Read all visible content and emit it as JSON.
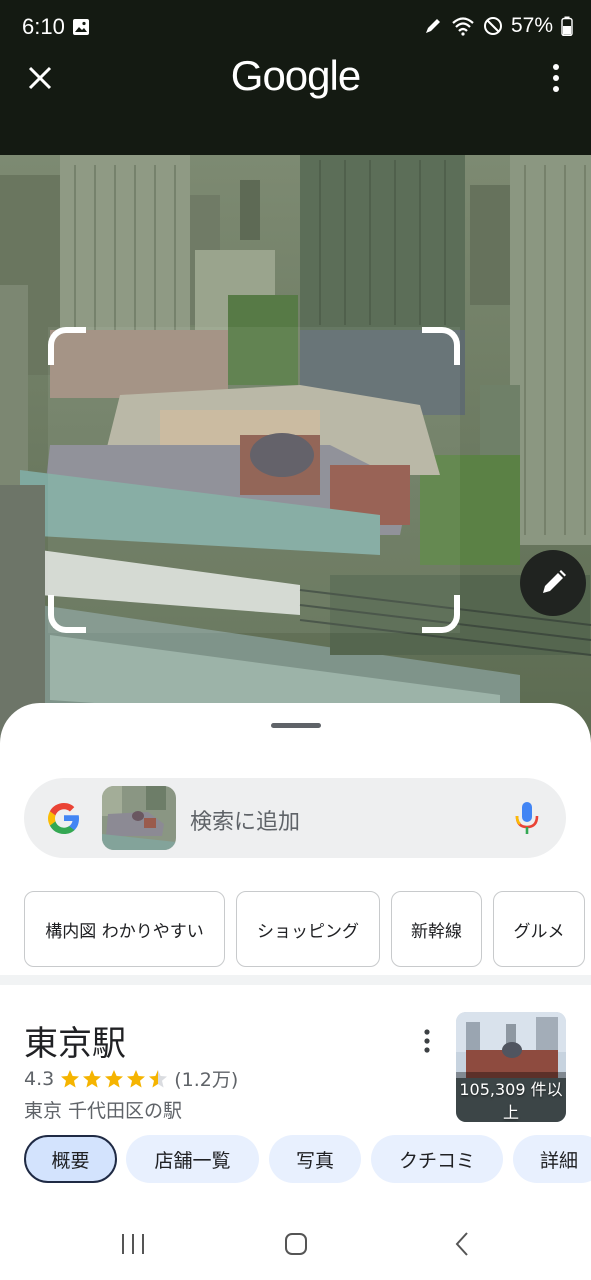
{
  "status_bar": {
    "time": "6:10",
    "battery": "57%"
  },
  "header": {
    "logo": "Google",
    "close_icon": "close-icon",
    "menu_icon": "more-vert-icon"
  },
  "photo": {
    "edit_icon": "pencil-icon"
  },
  "search": {
    "placeholder": "検索に追加"
  },
  "chips": [
    {
      "label": "構内図 わかりやすい"
    },
    {
      "label": "ショッピング"
    },
    {
      "label": "新幹線"
    },
    {
      "label": "グルメ"
    }
  ],
  "place": {
    "name": "東京駅",
    "rating": "4.3",
    "rating_value": 4.3,
    "review_count": "(1.2万)",
    "subtitle": "東京 千代田区の駅",
    "image_count": "105,309 件以上"
  },
  "tabs": [
    {
      "label": "概要",
      "active": true
    },
    {
      "label": "店舗一覧"
    },
    {
      "label": "写真"
    },
    {
      "label": "クチコミ"
    },
    {
      "label": "詳細"
    }
  ],
  "colors": {
    "accent_blue": "#4285F4",
    "accent_red": "#EA4335",
    "accent_yellow": "#FBBC05",
    "accent_green": "#34A853",
    "star": "#F5B400",
    "tab_bg": "#E8F0FE"
  }
}
